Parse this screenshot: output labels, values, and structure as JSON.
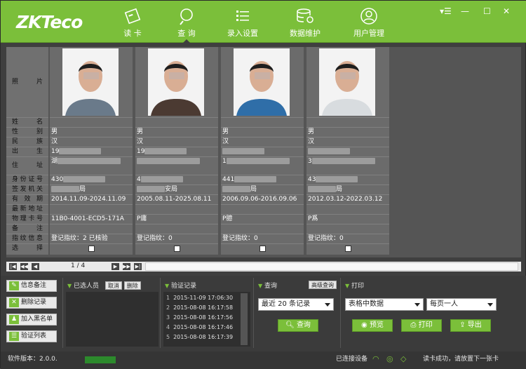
{
  "app": {
    "logo": "ZKTeco"
  },
  "nav": [
    {
      "label": "读 卡",
      "icon": "id-card-icon"
    },
    {
      "label": "查 询",
      "icon": "search-icon"
    },
    {
      "label": "录入设置",
      "icon": "list-settings-icon"
    },
    {
      "label": "数据维护",
      "icon": "database-gear-icon"
    },
    {
      "label": "用户管理",
      "icon": "user-icon"
    }
  ],
  "window_controls": {
    "menu": "▾☰",
    "minimize": "—",
    "maximize": "☐",
    "close": "✕"
  },
  "labels": [
    "照 片",
    "姓 名",
    "性 别",
    "民 族",
    "出 生",
    "住 址",
    "身份证号",
    "签发机关",
    "有 效 期",
    "最新地址",
    "物理卡号",
    "备 注",
    "指纹信息",
    "选 择"
  ],
  "records": [
    {
      "gender": "男",
      "nation": "汉",
      "birth": "19",
      "address": "湖",
      "id": "430",
      "authority": "局",
      "validity": "2014.11.09-2024.11.09",
      "card_no": "11B0-4001-ECD5-171A",
      "fingerprint": "登记指纹：2 已核验"
    },
    {
      "gender": "男",
      "nation": "汉",
      "birth": "19",
      "address": "",
      "id": "4",
      "authority": "安局",
      "validity": "2005.08.11-2025.08.11",
      "card_no": "P庸",
      "fingerprint": "登记指纹：0"
    },
    {
      "gender": "男",
      "nation": "汉",
      "birth": "",
      "address": "1",
      "id": "441",
      "authority": "局",
      "validity": "2006.09.06-2016.09.06",
      "card_no": "P臆",
      "fingerprint": "登记指纹：0"
    },
    {
      "gender": "男",
      "nation": "汉",
      "birth": "",
      "address": "3",
      "id": "43",
      "authority": "局",
      "validity": "2012.03.12-2022.03.12",
      "card_no": "P爲",
      "fingerprint": "登记指纹：0"
    }
  ],
  "pager": {
    "page": "1 / 4",
    "first": "|◀",
    "prev": "◀◀",
    "back": "◀",
    "fwd": "▶",
    "next": "▶▶",
    "last": "▶|"
  },
  "left_buttons": [
    {
      "label": "信息备注",
      "icon": "edit-icon"
    },
    {
      "label": "删除记录",
      "icon": "delete-icon"
    },
    {
      "label": "加入黑名单",
      "icon": "add-user-icon"
    },
    {
      "label": "验证列表",
      "icon": "list-icon"
    }
  ],
  "selected": {
    "title": "已选人员",
    "clear": "取消",
    "delete": "删除"
  },
  "verify": {
    "title": "验证记录",
    "rows": [
      "2015-11-09 17:06:30",
      "2015-08-08 16:17:58",
      "2015-08-08 16:17:56",
      "2015-08-08 16:17:46",
      "2015-08-08 16:17:39"
    ]
  },
  "query": {
    "title": "查询",
    "advanced": "高级查询",
    "range": "最近 20 条记录",
    "button": "查询"
  },
  "print": {
    "title": "打印",
    "mode": "表格中数据",
    "per_page": "每页一人",
    "preview": "预览",
    "print": "打印",
    "export": "导出"
  },
  "status": {
    "version": "软件版本：2.0.0.",
    "connected": "已连接设备",
    "message": "读卡成功，请放置下一张卡"
  },
  "colors": {
    "accent": "#7bbf3a"
  }
}
